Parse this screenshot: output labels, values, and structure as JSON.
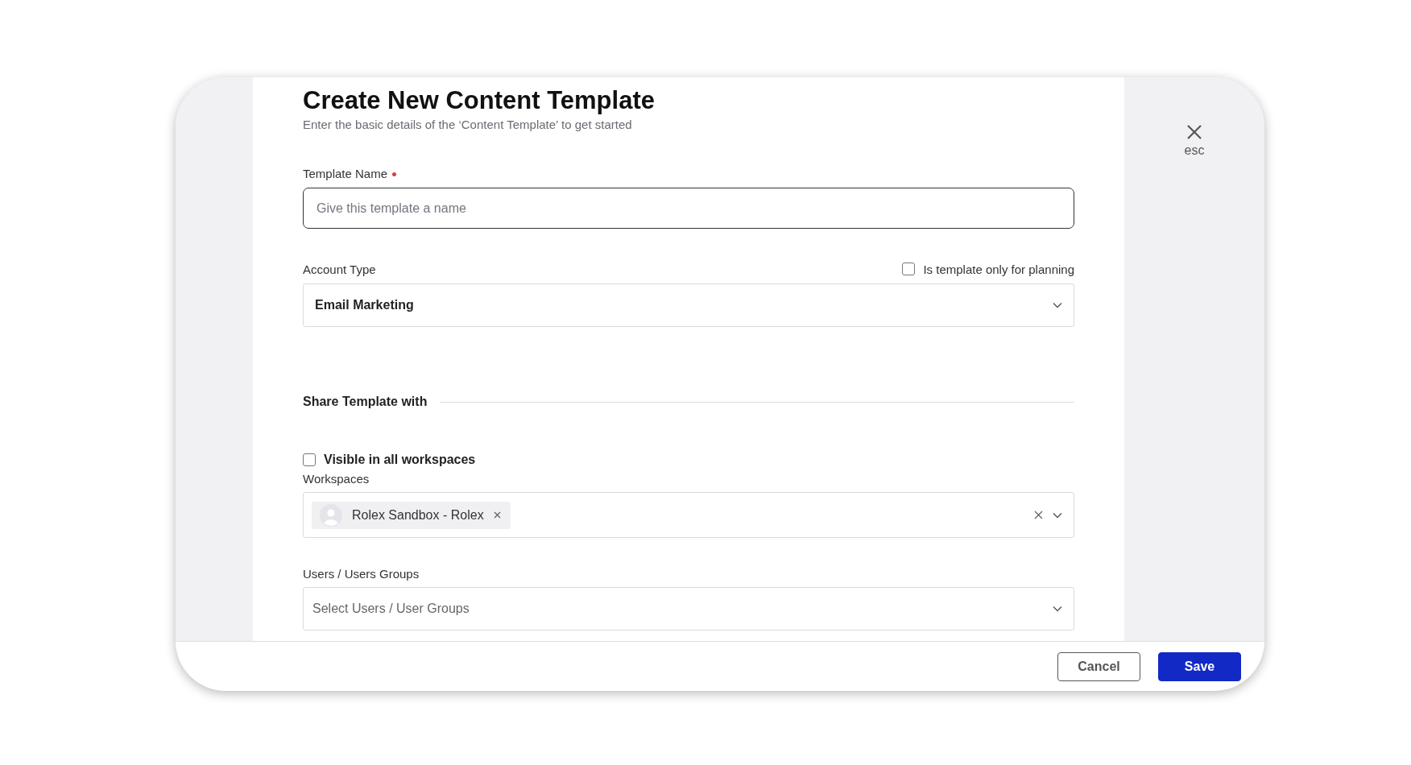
{
  "dialog": {
    "title": "Create New Content Template",
    "subtitle": "Enter the basic details of the ‘Content Template’ to get started",
    "close_label": "esc"
  },
  "template_name": {
    "label": "Template Name",
    "required": true,
    "placeholder": "Give this template a name"
  },
  "account_type": {
    "label": "Account Type",
    "value": "Email Marketing"
  },
  "planning_only": {
    "label": "Is template only for planning",
    "checked": false
  },
  "share_section": {
    "title": "Share Template with"
  },
  "visible_all": {
    "label": "Visible in all workspaces",
    "checked": false
  },
  "workspaces": {
    "label": "Workspaces",
    "chips": [
      {
        "label": "Rolex Sandbox - Rolex"
      }
    ]
  },
  "users": {
    "label": "Users / Users Groups",
    "placeholder": "Select Users / User Groups"
  },
  "buttons": [
    {
      "label": "Cancel",
      "kind": "secondary"
    },
    {
      "label": "Save",
      "kind": "primary"
    }
  ]
}
